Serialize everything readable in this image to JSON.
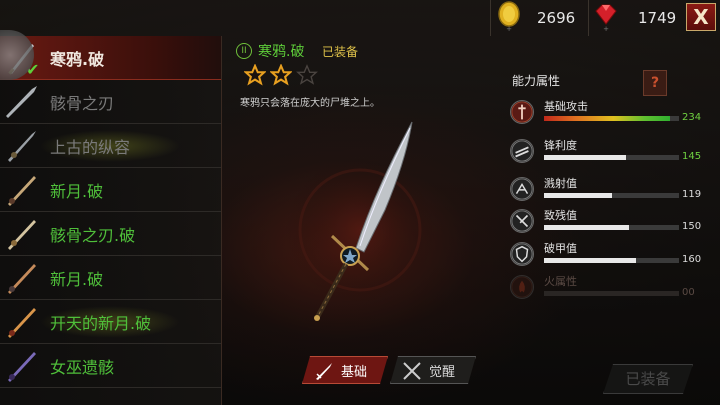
{
  "currency": {
    "coins": "2696",
    "gems": "1749",
    "close_label": "X"
  },
  "weapon_list": [
    {
      "name": "寒鸦.破",
      "style": "white",
      "selected": true
    },
    {
      "name": "骸骨之刃",
      "style": "dim"
    },
    {
      "name": "上古的纵容",
      "style": "dim"
    },
    {
      "name": "新月.破",
      "style": "green"
    },
    {
      "name": "骸骨之刃.破",
      "style": "green"
    },
    {
      "name": "新月.破",
      "style": "green"
    },
    {
      "name": "开天的新月.破",
      "style": "green"
    },
    {
      "name": "女巫遗骸",
      "style": "green"
    }
  ],
  "detail": {
    "rank_badge": "II",
    "title": "寒鸦.破",
    "equipped_tag": "已装备",
    "stars_filled": 2,
    "stars_total": 3,
    "description": "寒鸦只会落在庞大的尸堆之上。"
  },
  "stats": {
    "title": "能力属性",
    "help_label": "?",
    "items": [
      {
        "label": "基础攻击",
        "value": "234",
        "fill": 0.93,
        "color": "gradient",
        "icon": "attack-icon"
      },
      {
        "label": "锋利度",
        "value": "145",
        "fill": 0.61,
        "color": "#e8e8e8",
        "icon": "sharpness-icon"
      },
      {
        "label": "溅射值",
        "value": "119",
        "fill": 0.5,
        "color": "#e8e8e8",
        "icon": "splash-icon"
      },
      {
        "label": "致残值",
        "value": "150",
        "fill": 0.63,
        "color": "#e8e8e8",
        "icon": "cripple-icon"
      },
      {
        "label": "破甲值",
        "value": "160",
        "fill": 0.68,
        "color": "#e8e8e8",
        "icon": "armor-break-icon"
      },
      {
        "label": "火属性",
        "value": "00",
        "fill": 0,
        "color": "#e8e8e8",
        "icon": "fire-icon",
        "dim": true
      }
    ]
  },
  "tabs": {
    "basic": "基础",
    "awaken": "觉醒"
  },
  "equip_button": "已装备"
}
